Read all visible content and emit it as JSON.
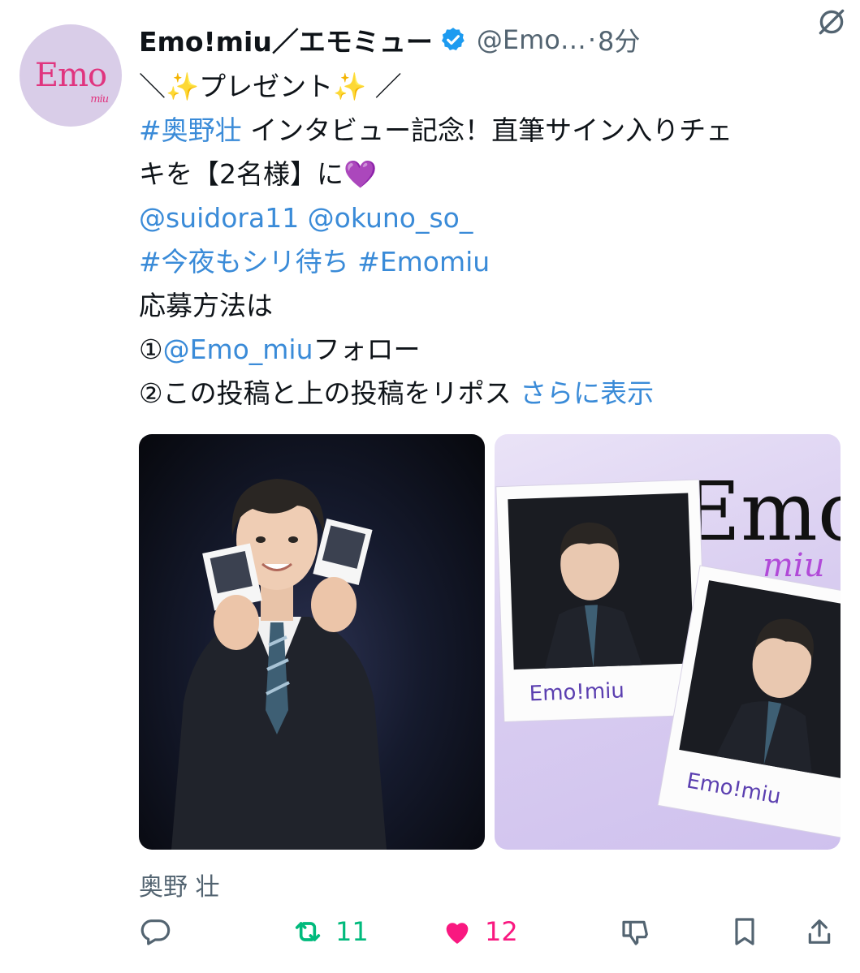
{
  "tweet": {
    "author_name": "Emo!miu／エモミュー",
    "handle": "@Emo…",
    "separator": "·",
    "time": "8分",
    "avatar_text": "Emo",
    "avatar_subtext": "miu",
    "lines": {
      "l1": "＼✨プレゼント✨ ／",
      "l2_tag": "#奥野壮",
      "l2_rest": " インタビュー記念！直筆サイン入りチェ",
      "l3": "キを【2名様】に💜",
      "l4": "@suidora11 @okuno_so_",
      "l5": "#今夜もシリ待ち #Emomiu",
      "l6": "応募方法は",
      "l7_prefix": "①",
      "l7_mention": "@Emo_miu",
      "l7_rest": "フォロー",
      "l8": "②この投稿と上の投稿をリポス",
      "l8_more": "さらに表示"
    },
    "media": [
      {
        "icon": "person-photo-icon"
      },
      {
        "icon": "polaroid-photo-icon",
        "overlay_logo": "Emo",
        "overlay_sub": "miu",
        "polaroid_caption": "Emo!miu"
      }
    ],
    "media_caption": "奥野 壮",
    "actions": {
      "reply": {
        "icon": "reply-icon"
      },
      "retweet": {
        "icon": "retweet-icon",
        "count": "11"
      },
      "like": {
        "icon": "heart-icon",
        "count": "12"
      },
      "dislike": {
        "icon": "downvote-icon"
      },
      "bookmark": {
        "icon": "bookmark-icon"
      },
      "share": {
        "icon": "share-icon"
      }
    },
    "colors": {
      "link": "#3a8bd8",
      "retweet": "#00ba7c",
      "like": "#f91880",
      "verified": "#1d9bf0"
    }
  }
}
